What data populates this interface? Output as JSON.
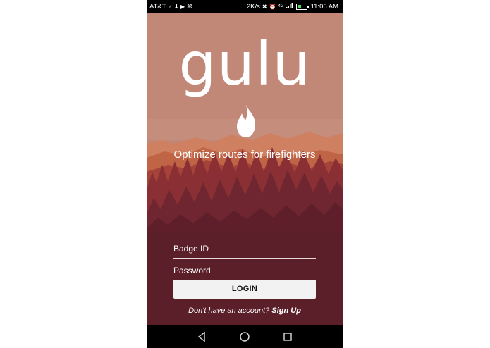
{
  "status_bar": {
    "carrier": "AT&T",
    "net_speed": "2K/s",
    "network": "4G",
    "time": "11:06 AM",
    "icons": [
      "usb-icon",
      "download-icon",
      "play-store-icon",
      "notification-icon",
      "mute-icon",
      "alarm-icon",
      "signal-icon",
      "battery-icon"
    ]
  },
  "app": {
    "logo_text": "gulu",
    "tagline": "Optimize routes for firefighters",
    "fields": {
      "badge_id_label": "Badge ID",
      "password_label": "Password"
    },
    "login_label": "LOGIN",
    "signup_prompt": "Don't have an account?",
    "signup_link": "Sign Up"
  },
  "nav_bar": {
    "icons": [
      "back-icon",
      "home-icon",
      "recents-icon"
    ]
  },
  "colors": {
    "sky": "#c18777",
    "far_mountains": "#cf8060",
    "mid_mountains": "#b3503a",
    "forest_front": "#6e2530",
    "ground": "#5a1f29",
    "button_bg": "#f2f2f2"
  }
}
